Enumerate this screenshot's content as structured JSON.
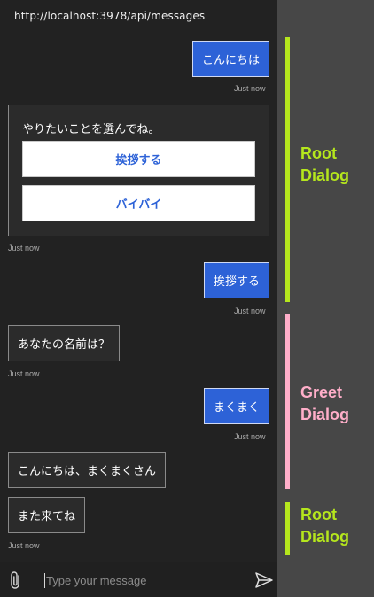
{
  "window": {
    "url": "http://localhost:3978/api/messages"
  },
  "messages": {
    "m1": {
      "text": "こんにちは",
      "time": "Just now"
    },
    "card": {
      "title": "やりたいことを選んでね。",
      "button1": "挨拶する",
      "button2": "バイバイ",
      "time": "Just now"
    },
    "m2": {
      "text": "挨拶する",
      "time": "Just now"
    },
    "m3": {
      "text": "あなたの名前は？",
      "time": "Just now"
    },
    "m4": {
      "text": "まくまく",
      "time": "Just now"
    },
    "m5": {
      "text": "こんにちは、まくまくさん"
    },
    "m6": {
      "text": "また来てね",
      "time": "Just now"
    }
  },
  "composer": {
    "placeholder": "Type your message"
  },
  "annotations": [
    {
      "label_line1": "Root",
      "label_line2": "Dialog",
      "color": "#b5e61d"
    },
    {
      "label_line1": "Greet",
      "label_line2": "Dialog",
      "color": "#ffaec9"
    },
    {
      "label_line1": "Root",
      "label_line2": "Dialog",
      "color": "#b5e61d"
    }
  ],
  "icons": {
    "attach": "paperclip-icon",
    "send": "send-icon"
  }
}
